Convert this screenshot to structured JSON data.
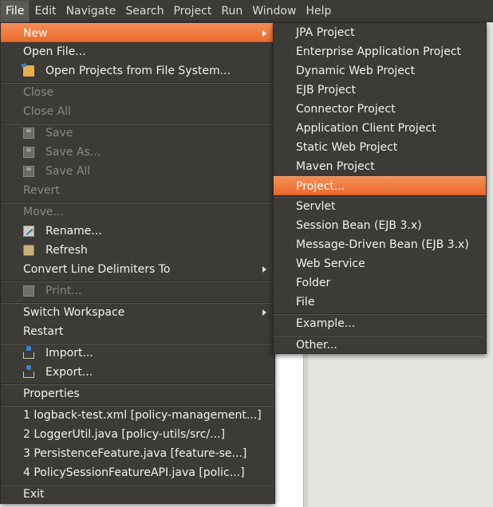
{
  "menubar": [
    "File",
    "Edit",
    "Navigate",
    "Search",
    "Project",
    "Run",
    "Window",
    "Help"
  ],
  "file_menu": {
    "new": "New",
    "open_file": "Open File...",
    "open_projects": "Open Projects from File System...",
    "close": "Close",
    "close_all": "Close All",
    "save": "Save",
    "save_as": "Save As...",
    "save_all": "Save All",
    "revert": "Revert",
    "move": "Move...",
    "rename": "Rename...",
    "refresh": "Refresh",
    "convert_line_delimiters": "Convert Line Delimiters To",
    "print": "Print...",
    "switch_workspace": "Switch Workspace",
    "restart": "Restart",
    "import": "Import...",
    "export": "Export...",
    "properties": "Properties",
    "recent": [
      "1 logback-test.xml  [policy-management...]",
      "2 LoggerUtil.java  [policy-utils/src/...]",
      "3 PersistenceFeature.java  [feature-se...]",
      "4 PolicySessionFeatureAPI.java  [polic...]"
    ],
    "exit": "Exit"
  },
  "new_menu": {
    "items": [
      "JPA Project",
      "Enterprise Application Project",
      "Dynamic Web Project",
      "EJB Project",
      "Connector Project",
      "Application Client Project",
      "Static Web Project",
      "Maven Project",
      "Project...",
      "Servlet",
      "Session Bean (EJB 3.x)",
      "Message-Driven Bean (EJB 3.x)",
      "Web Service",
      "Folder",
      "File"
    ],
    "example": "Example...",
    "other": "Other..."
  },
  "icons": {
    "open_projects": "folder-open-icon",
    "save": "save-icon",
    "save_as": "save-as-icon",
    "save_all": "save-all-icon",
    "rename": "rename-icon",
    "refresh": "refresh-icon",
    "print": "printer-icon",
    "import": "import-icon",
    "export": "export-icon"
  },
  "colors": {
    "menu_bg": "#3c3b37",
    "highlight": "#f07746",
    "disabled_text": "#8a8984",
    "text": "#f2f1f0"
  }
}
